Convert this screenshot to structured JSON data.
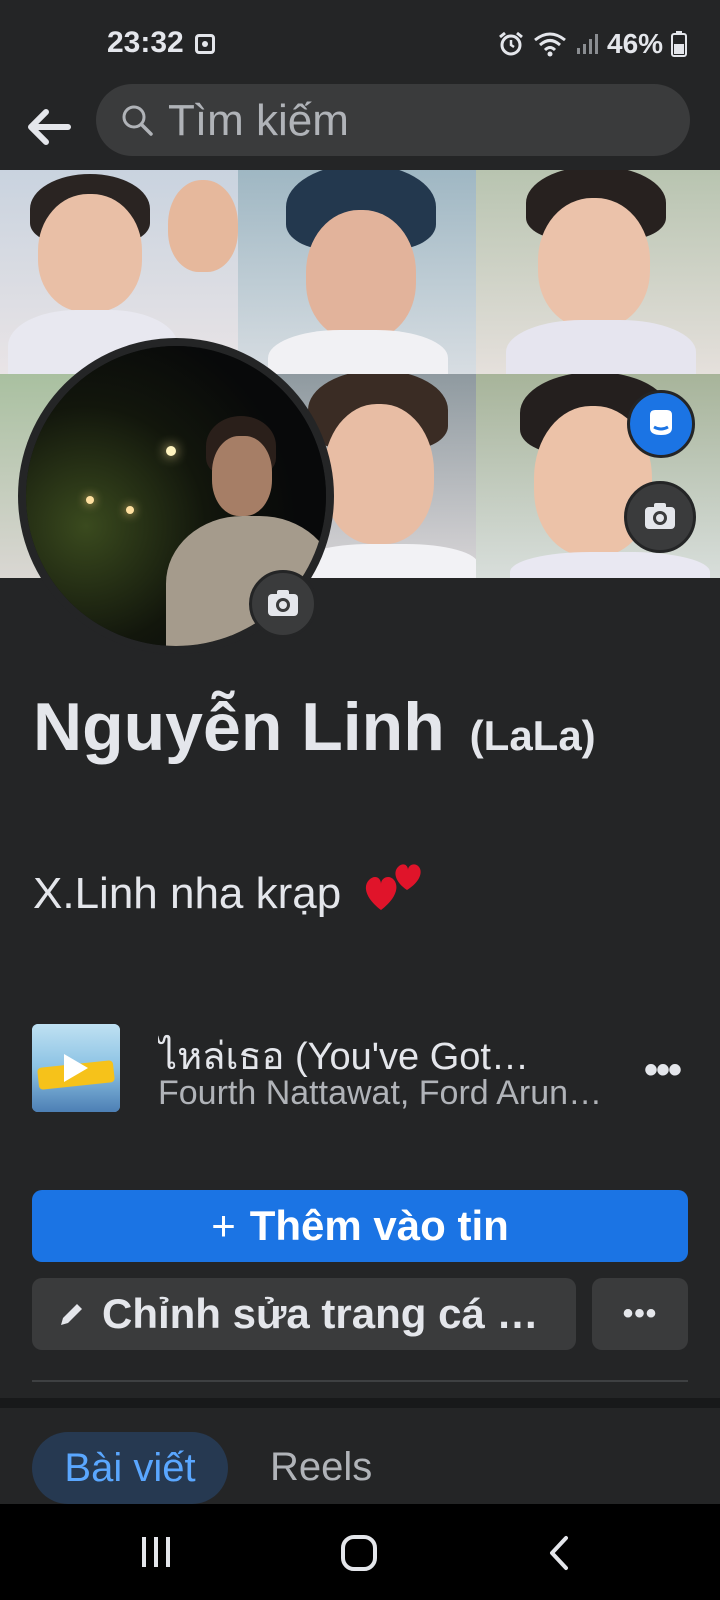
{
  "status_bar": {
    "time": "23:32",
    "battery": "46%",
    "icons": [
      "screenshot-icon",
      "alarm-icon",
      "wifi-icon",
      "signal-icon",
      "battery-icon"
    ]
  },
  "header": {
    "back_icon": "arrow-left-icon",
    "search_placeholder": "Tìm kiếm"
  },
  "profile": {
    "name": "Nguyễn Linh",
    "nickname": "(LaLa)",
    "bio": "X.Linh nha krạp",
    "bio_emoji": "two-hearts-icon"
  },
  "music": {
    "title": "ไหล่เธอ (You've Got…",
    "artist": "Fourth Nattawat, Ford Arun…",
    "more": "•••"
  },
  "actions": {
    "add_story": "Thêm vào tin",
    "edit_profile": "Chỉnh sửa trang cá n…",
    "more": "•••"
  },
  "tabs": [
    {
      "label": "Bài viết",
      "active": true
    },
    {
      "label": "Reels",
      "active": false
    }
  ],
  "colors": {
    "background": "#242526",
    "primary": "#1b74e4",
    "secondary_button": "#3a3b3c",
    "active_tab_bg": "#263951",
    "active_tab_text": "#5aa7ff"
  }
}
